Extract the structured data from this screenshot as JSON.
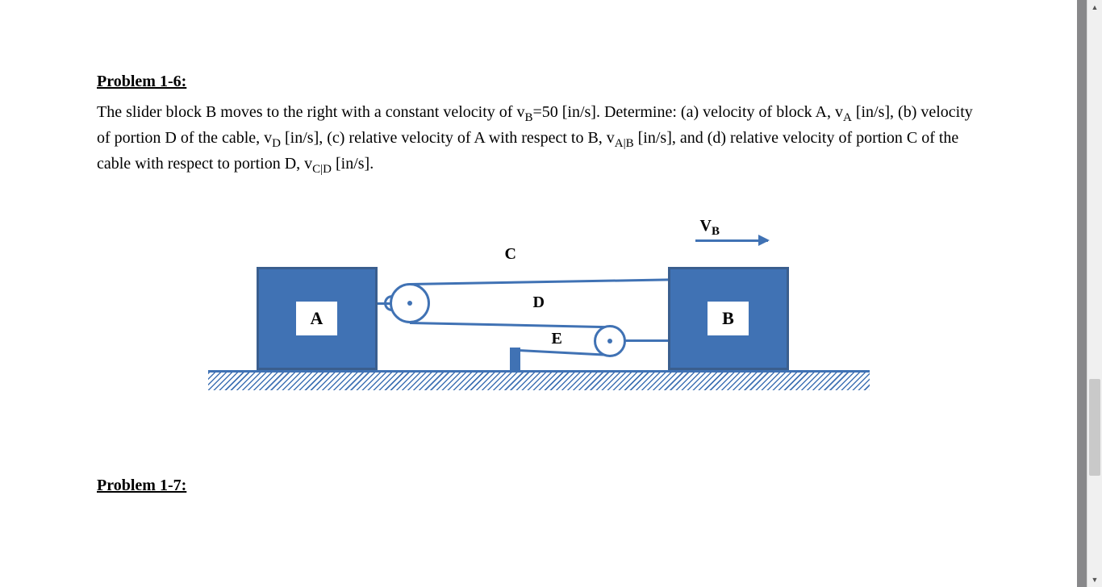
{
  "problem1": {
    "heading": "Problem 1-6:",
    "text_parts": {
      "p1": "The slider block B moves to the right with a constant velocity of v",
      "p1_sub": "B",
      "p1b": "=50 [in/s]. Determine: (a) velocity of block A, v",
      "p1b_sub": "A",
      "p1c": " [in/s], (b) velocity of portion D of the cable, v",
      "p1c_sub": "D",
      "p1d": " [in/s], (c) relative velocity of A with respect to B, v",
      "p1d_sub": "A|B",
      "p1e": " [in/s], and (d) relative velocity of portion C of the cable with respect to portion D, v",
      "p1e_sub": "C|D",
      "p1f": " [in/s]."
    }
  },
  "figure": {
    "block_a_label": "A",
    "block_b_label": "B",
    "cable_c": "C",
    "cable_d": "D",
    "cable_e": "E",
    "velocity_label_main": "V",
    "velocity_label_sub": "B"
  },
  "problem2": {
    "heading": "Problem 1-7:"
  }
}
